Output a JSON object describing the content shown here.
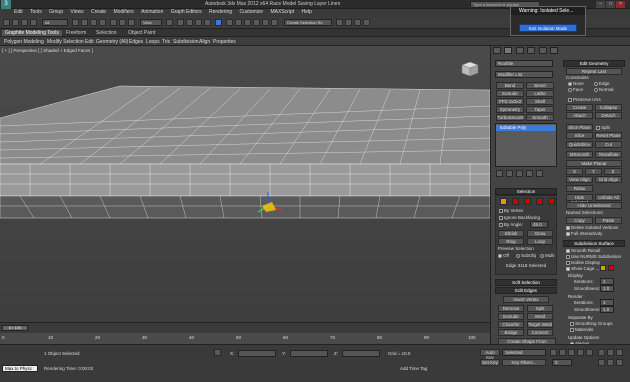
{
  "app": {
    "logo": "3",
    "title": "Autodesk 3ds Max  2012 x64      Race Model Saving Layer Linen",
    "search_placeholder": "Type a keyword or phrase"
  },
  "menus": [
    "Edit",
    "Tools",
    "Group",
    "Views",
    "Create",
    "Modifiers",
    "Animation",
    "Graph Editors",
    "Rendering",
    "Customize",
    "MAXScript",
    "Help"
  ],
  "toolbar": {
    "undo_dropdown": "All",
    "view_dropdown": "View",
    "selection_set_placeholder": "Create Selection Se"
  },
  "ribbon": {
    "tabs": [
      "Graphite Modeling Tools",
      "Freeform",
      "Selection",
      "Object Paint"
    ],
    "items": [
      "Polygon Modeling",
      "Modify Selection",
      "Edit",
      "Geometry (All)",
      "Edges",
      "Loops",
      "Tris",
      "Subdivision",
      "Align",
      "Properties"
    ]
  },
  "viewport": {
    "label": "[ + ] [ Perspective ] [ Shaded + Edged Faces ]"
  },
  "popup": {
    "title": "Warning: Isolated Sele...",
    "button": "Exit Isolation Mode"
  },
  "command_panel": {
    "object_name": "Rooftile",
    "modifier_list": "Modifier List",
    "buttons": [
      "Bend",
      "Bevel",
      "Extrude",
      "Lathe",
      "FFD 3x3x3",
      "Shell",
      "Symmetry",
      "Taper",
      "TurboSmooth",
      "Smooth"
    ],
    "stack_item": "Editable Poly",
    "selection": {
      "header": "Selection",
      "by_vertex": "By Vertex",
      "ignore_backfacing": "Ignore Backfacing",
      "by_angle": "By Angle:",
      "angle_value": "45.0",
      "shrink": "Shrink",
      "grow": "Grow",
      "ring": "Ring",
      "loop": "Loop",
      "preview_selection": "Preview Selection",
      "preview_opts": [
        "Off",
        "SubObj",
        "Multi"
      ],
      "status": "Edge 3118 Selected"
    },
    "soft_selection": {
      "header": "Soft Selection",
      "edit_edges": "Edit Edges",
      "insert_vertex": "Insert Vertex",
      "remove": "Remove",
      "split": "Split",
      "extrude": "Extrude",
      "weld": "Weld",
      "chamfer": "Chamfer",
      "target_weld": "Target Weld",
      "bridge": "Bridge",
      "connect": "Connect",
      "create_shape": "Create Shape From Selection",
      "weight_label": "Weight:",
      "weight_value": "1.0",
      "crease_label": "Crease:",
      "crease_value": "0.0"
    },
    "edit_geometry": {
      "header": "Edit Geometry",
      "repeat_last": "Repeat Last",
      "constraints": "Constraints",
      "none": "None",
      "edge": "Edge",
      "face": "Face",
      "normal": "Normal",
      "preserve_uvs": "Preserve UVs",
      "create": "Create",
      "collapse": "Collapse",
      "attach": "Attach",
      "detach": "Detach",
      "slice_plane": "Slice Plane",
      "split": "Split",
      "slice": "Slice",
      "reset_plane": "Reset Plane",
      "quickslice": "QuickSlice",
      "cut": "Cut",
      "msmooth": "MSmooth",
      "tessellate": "Tessellate",
      "make_planar": "Make Planar",
      "x": "X",
      "y": "Y",
      "z": "Z",
      "view_align": "View Align",
      "grid_align": "Grid Align",
      "relax": "Relax",
      "hide_selected": "Hide Selected",
      "unhide_all": "Unhide All",
      "hide_unselected": "Hide Unselected",
      "named_selections": "Named Selections:",
      "copy": "Copy",
      "paste": "Paste",
      "delete_isolated": "Delete Isolated Vertices",
      "full_interactivity": "Full Interactivity"
    },
    "subdivision": {
      "header": "Subdivision Surface",
      "smooth_result": "Smooth Result",
      "use_nurms": "Use NURMS Subdivision",
      "isoline_display": "Isoline Display",
      "show_cage": "Show Cage......",
      "display": "Display",
      "iterations_label": "Iterations:",
      "iterations_value": "1",
      "smoothness_label": "Smoothness:",
      "smoothness_value": "1.0",
      "render": "Render",
      "separate_by": "Separate By",
      "smoothing_groups": "Smoothing Groups",
      "materials": "Materials",
      "update_options": "Update Options",
      "always": "Always",
      "when_rendering": "When Rendering",
      "manually": "Manually"
    }
  },
  "timeline": {
    "frame": "0 / 100",
    "ticks": [
      "0",
      "10",
      "20",
      "30",
      "40",
      "50",
      "60",
      "70",
      "80",
      "90",
      "100"
    ]
  },
  "status": {
    "script_label": "Max to Physc",
    "selection": "1 Object Selected",
    "x_label": "X:",
    "y_label": "Y:",
    "z_label": "Z:",
    "grid": "Grid = 10.0",
    "auto_key": "Auto Key",
    "selected": "Selected",
    "set_key": "Set Key",
    "key_filters": "Key Filters...",
    "render_time": "Rendering Time: 0:00:02",
    "add_time_tag": "Add Time Tag",
    "frame_value": "0"
  }
}
